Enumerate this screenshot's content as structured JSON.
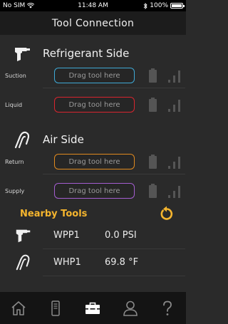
{
  "status": {
    "carrier": "No SIM",
    "time": "11:48 AM",
    "battery": "100%"
  },
  "header": {
    "title": "Tool Connection"
  },
  "refrigerant": {
    "title": "Refrigerant Side",
    "rows": [
      {
        "label": "Suction",
        "placeholder": "Drag tool here",
        "color": "#3fa9d6"
      },
      {
        "label": "Liquid",
        "placeholder": "Drag tool here",
        "color": "#d9252f"
      }
    ]
  },
  "air": {
    "title": "Air Side",
    "rows": [
      {
        "label": "Return",
        "placeholder": "Drag tool here",
        "color": "#e08a1f"
      },
      {
        "label": "Supply",
        "placeholder": "Drag tool here",
        "color": "#a45ed0"
      }
    ]
  },
  "nearby": {
    "title": "Nearby Tools",
    "tools": [
      {
        "name": "WPP1",
        "value": "0.0 PSI",
        "icon": "pressure-probe-icon"
      },
      {
        "name": "WHP1",
        "value": "69.8 °F",
        "icon": "clamp-probe-icon"
      }
    ]
  },
  "colors": {
    "accent": "#f5b52e",
    "background": "#2a2a2a",
    "tabbar": "#141414"
  },
  "tabs": [
    {
      "icon": "home-icon",
      "active": false
    },
    {
      "icon": "tool-icon",
      "active": false
    },
    {
      "icon": "toolbox-icon",
      "active": true
    },
    {
      "icon": "user-icon",
      "active": false
    },
    {
      "icon": "help-icon",
      "active": false
    }
  ]
}
